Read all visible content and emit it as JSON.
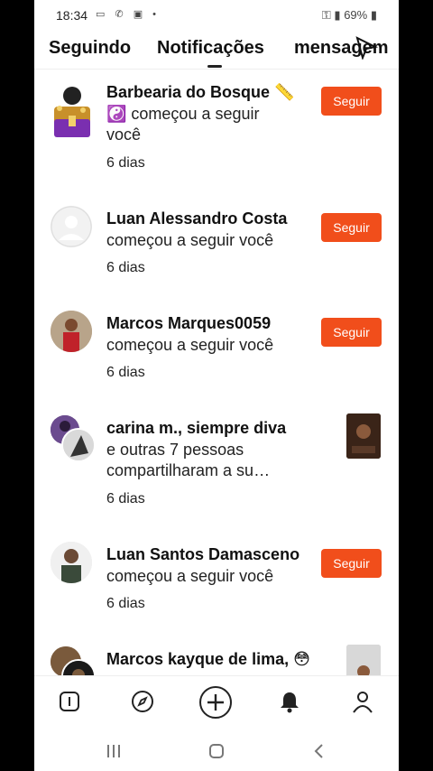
{
  "status_bar": {
    "time": "18:34",
    "battery": "69%",
    "left_icons": [
      "video-icon",
      "call-icon",
      "image-icon",
      "dot"
    ],
    "right_icons": [
      "key-icon",
      "lock-icon",
      "mute-icon",
      "volte-icon",
      "4g-icon",
      "signal-icon",
      "battery-icon"
    ]
  },
  "tabs": [
    {
      "label": "Seguindo"
    },
    {
      "label": "Notificações"
    },
    {
      "label": "mensagem"
    }
  ],
  "notifications": [
    {
      "name": "Barbearia do Bosque 📏",
      "line1": "☯️ começou a seguir",
      "line2": "você",
      "time": "6 dias",
      "action": "Seguir"
    },
    {
      "name": "Luan Alessandro Costa",
      "line1": "começou a seguir você",
      "time": "6 dias",
      "action": "Seguir"
    },
    {
      "name": "Marcos Marques0059",
      "line1": "começou a seguir você",
      "time": "6 dias",
      "action": "Seguir"
    },
    {
      "name": "carina m., siempre diva",
      "line1": "e outras 7 pessoas",
      "line2": "compartilharam a su…",
      "time": "6 dias"
    },
    {
      "name": "Luan Santos Damasceno",
      "line1": "começou a seguir você",
      "time": "6 dias",
      "action": "Seguir"
    },
    {
      "name": "Marcos kayque de lima, 😳"
    }
  ],
  "colors": {
    "accent": "#f14e1b",
    "text": "#111111"
  }
}
